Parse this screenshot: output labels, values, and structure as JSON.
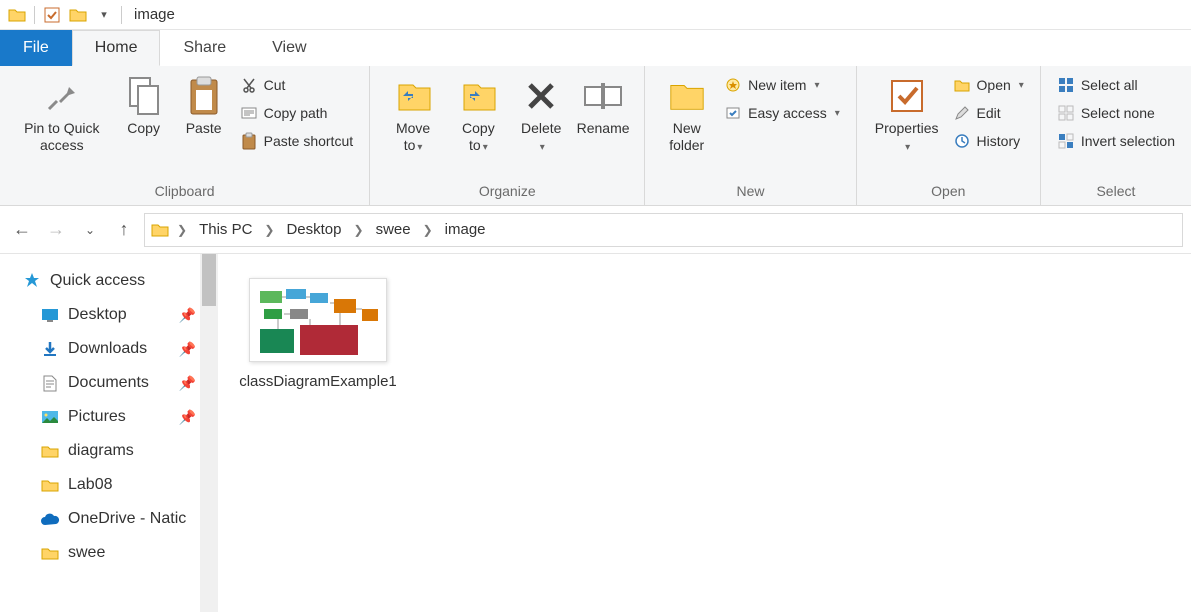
{
  "window": {
    "title": "image"
  },
  "tabs": {
    "file": "File",
    "home": "Home",
    "share": "Share",
    "view": "View"
  },
  "ribbon": {
    "clipboard": {
      "label": "Clipboard",
      "pin": "Pin to Quick access",
      "copy": "Copy",
      "paste": "Paste",
      "cut": "Cut",
      "copypath": "Copy path",
      "pasteshort": "Paste shortcut"
    },
    "organize": {
      "label": "Organize",
      "moveto": "Move to",
      "copyto": "Copy to",
      "delete": "Delete",
      "rename": "Rename"
    },
    "new": {
      "label": "New",
      "newfolder": "New folder",
      "newitem": "New item",
      "easyaccess": "Easy access"
    },
    "open": {
      "label": "Open",
      "properties": "Properties",
      "open": "Open",
      "edit": "Edit",
      "history": "History"
    },
    "select": {
      "label": "Select",
      "selectall": "Select all",
      "selectnone": "Select none",
      "invert": "Invert selection"
    }
  },
  "breadcrumb": [
    "This PC",
    "Desktop",
    "swee",
    "image"
  ],
  "nav": {
    "quickaccess": "Quick access",
    "items": [
      {
        "label": "Desktop",
        "pinned": true
      },
      {
        "label": "Downloads",
        "pinned": true
      },
      {
        "label": "Documents",
        "pinned": true
      },
      {
        "label": "Pictures",
        "pinned": true
      },
      {
        "label": "diagrams",
        "pinned": false
      },
      {
        "label": "Lab08",
        "pinned": false
      },
      {
        "label": "OneDrive - Natic",
        "pinned": false
      },
      {
        "label": "swee",
        "pinned": false
      }
    ]
  },
  "files": [
    {
      "name": "classDiagramExample1"
    }
  ]
}
